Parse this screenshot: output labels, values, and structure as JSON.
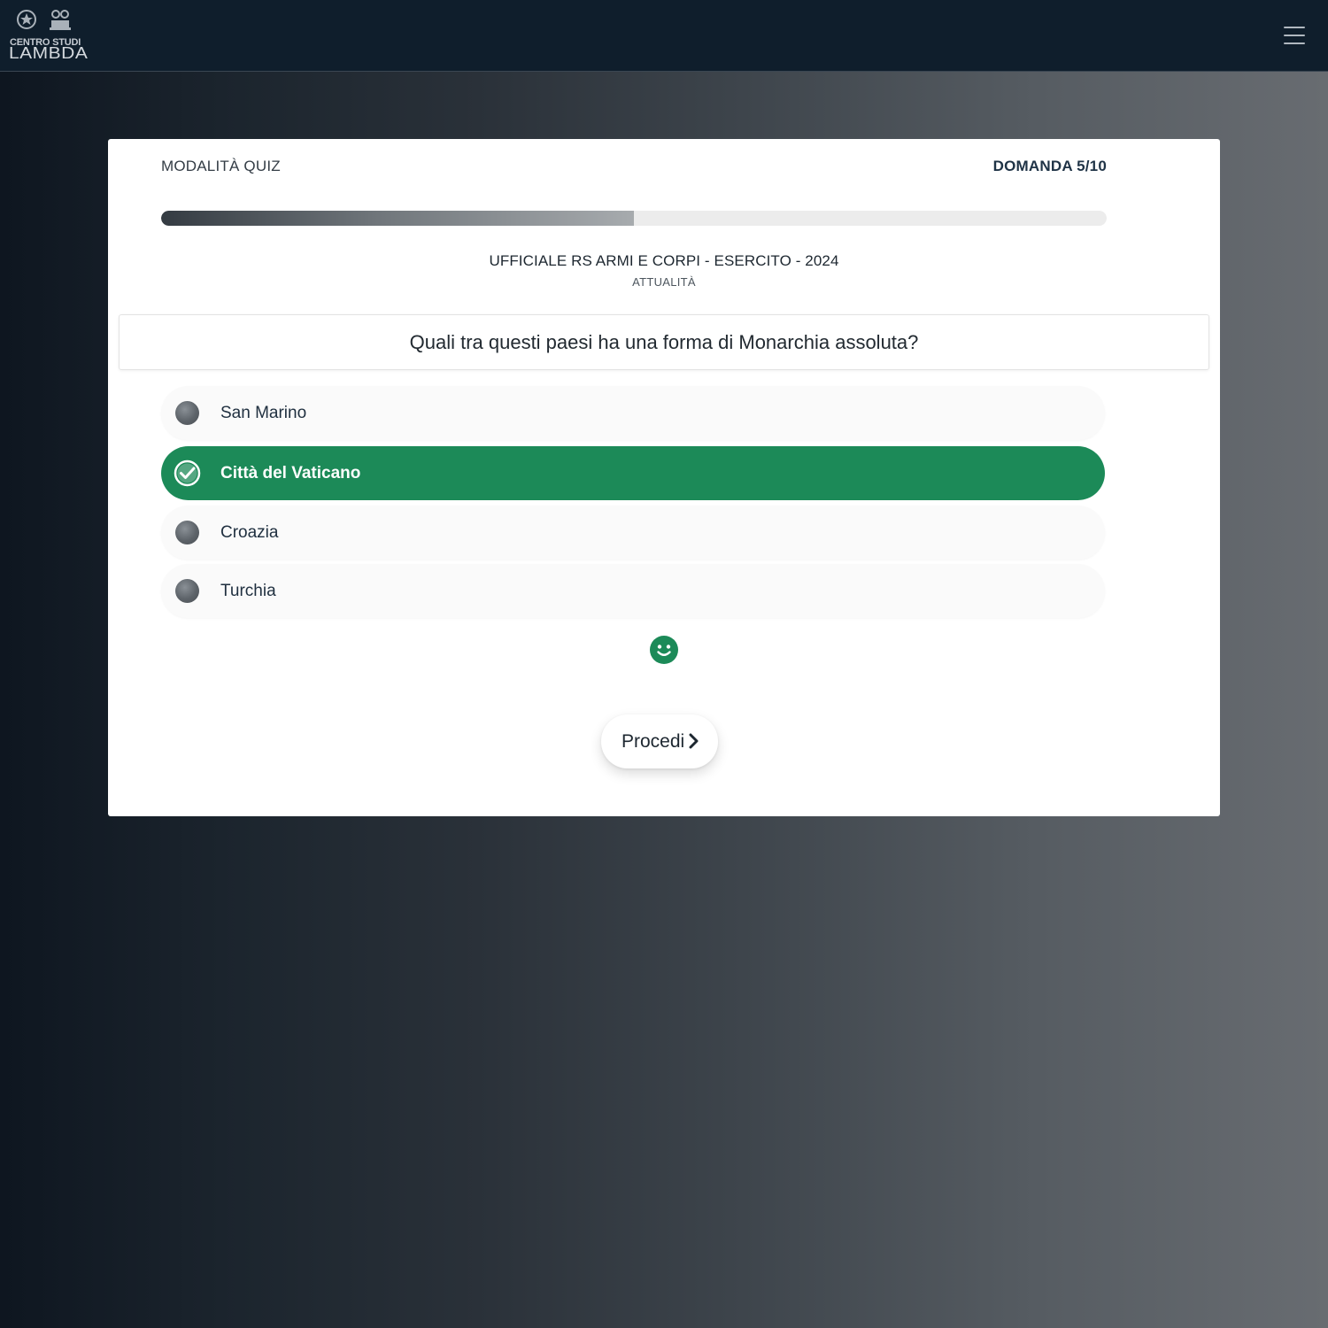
{
  "brand": {
    "logo_top_text": "CENTRO STUDI",
    "logo_main_text": "LAMBDA"
  },
  "header": {
    "menu_icon": "hamburger-menu-icon"
  },
  "quiz": {
    "mode_label": "MODALITÀ QUIZ",
    "counter_label": "DOMANDA 5/10",
    "progress_fraction": 0.5,
    "exam_title": "UFFICIALE RS ARMI E CORPI - ESERCITO - 2024",
    "subject": "ATTUALITÀ",
    "question": "Quali tra questi paesi ha una forma di Monarchia assoluta?",
    "answers": [
      {
        "label": "San Marino",
        "selected": false
      },
      {
        "label": "Città del Vaticano",
        "selected": true
      },
      {
        "label": "Croazia",
        "selected": false
      },
      {
        "label": "Turchia",
        "selected": false
      }
    ],
    "feedback_icon": "smiley-icon",
    "proceed_label": "Procedi"
  },
  "colors": {
    "correct_green": "#1c8a58",
    "header_bg": "#0f1e2c",
    "text_dark": "#1f2f3f"
  }
}
